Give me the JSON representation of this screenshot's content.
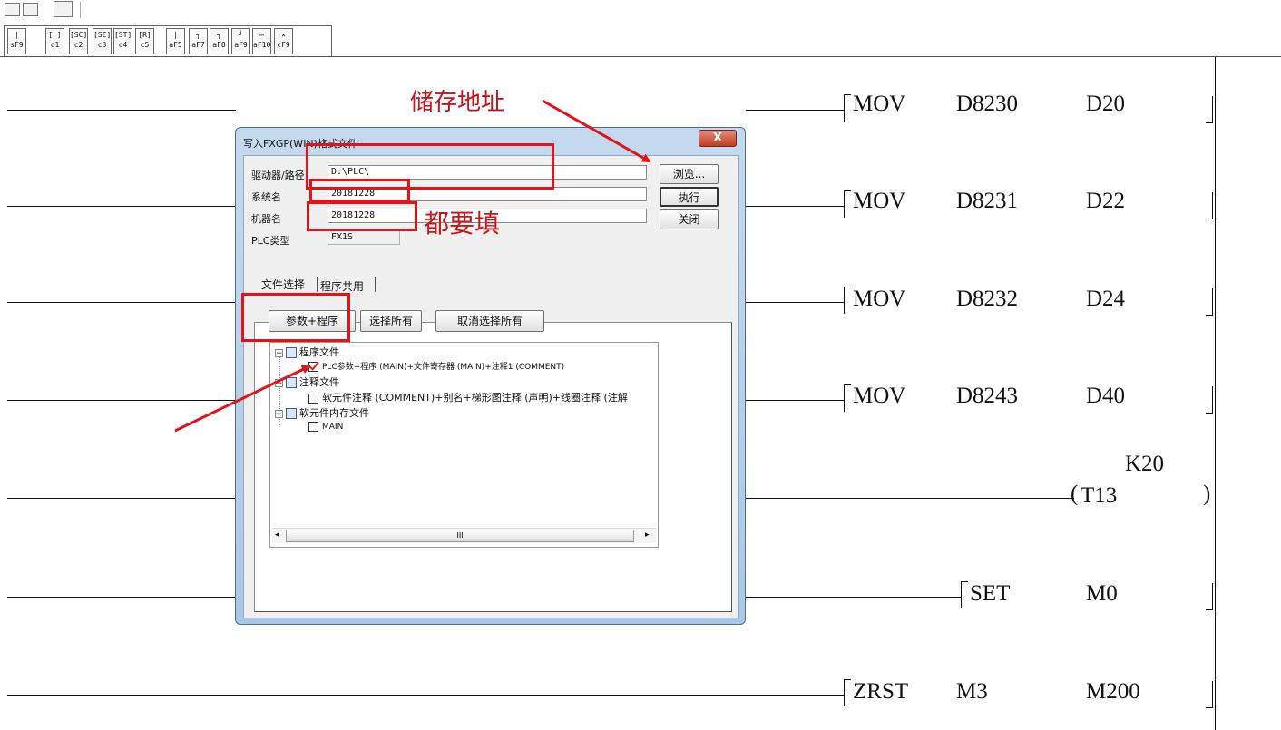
{
  "toolbar": {
    "fkeys": [
      {
        "sym": "|",
        "label": "sF9"
      },
      {
        "sym": "[ ]",
        "label": "c1"
      },
      {
        "sym": "[SC]",
        "label": "c2"
      },
      {
        "sym": "[SE]",
        "label": "c3"
      },
      {
        "sym": "[ST]",
        "label": "c4"
      },
      {
        "sym": "[R]",
        "label": "c5"
      },
      {
        "sym": "|",
        "label": "aF5"
      },
      {
        "sym": "┐",
        "label": "aF7"
      },
      {
        "sym": "┐",
        "label": "aF8"
      },
      {
        "sym": "┘",
        "label": "aF9"
      },
      {
        "sym": "═",
        "label": "aF10"
      },
      {
        "sym": "✕",
        "label": "cF9"
      }
    ]
  },
  "ladder": {
    "rungs": [
      {
        "instr": "MOV",
        "op1": "D8230",
        "op2": "D20"
      },
      {
        "instr": "MOV",
        "op1": "D8231",
        "op2": "D22"
      },
      {
        "instr": "MOV",
        "op1": "D8232",
        "op2": "D24"
      },
      {
        "instr": "MOV",
        "op1": "D8243",
        "op2": "D40"
      },
      {
        "timer": "T13",
        "preset": "K20"
      },
      {
        "instr": "SET",
        "op1": "M0"
      },
      {
        "instr": "ZRST",
        "op1": "M3",
        "op2": "M200"
      }
    ]
  },
  "dialog": {
    "title": "写入FXGP(WIN)格式文件",
    "close_label": "X",
    "drive_label": "驱动器/路径",
    "drive_value": "D:\\PLC\\",
    "system_label": "系统名",
    "system_value": "20181228",
    "machine_label": "机器名",
    "machine_value": "20181228",
    "plc_label": "PLC类型",
    "plc_value": "FX1S",
    "browse_label": "浏览...",
    "execute_label": "执行",
    "close_button_label": "关闭",
    "tabs": [
      "文件选择",
      "程序共用"
    ],
    "param_button": "参数+程序",
    "select_all_button": "选择所有",
    "deselect_all_button": "取消选择所有",
    "tree": {
      "program_files": "程序文件",
      "program_item": "PLC参数+程序 (MAIN)+文件寄存器 (MAIN)+注释1 (COMMENT)",
      "comment_files": "注释文件",
      "comment_item": "软元件注释 (COMMENT)+别名+梯形图注释 (声明)+线圈注释 (注解",
      "memory_files": "软元件内存文件",
      "memory_item": "MAIN"
    },
    "scroll_thumb": "III"
  },
  "annotations": {
    "storage_address": "储存地址",
    "must_fill": "都要填"
  },
  "colors": {
    "annotation_red": "#e1141c",
    "dialog_frame": "#aac8e6",
    "close_red": "#c23a22"
  }
}
